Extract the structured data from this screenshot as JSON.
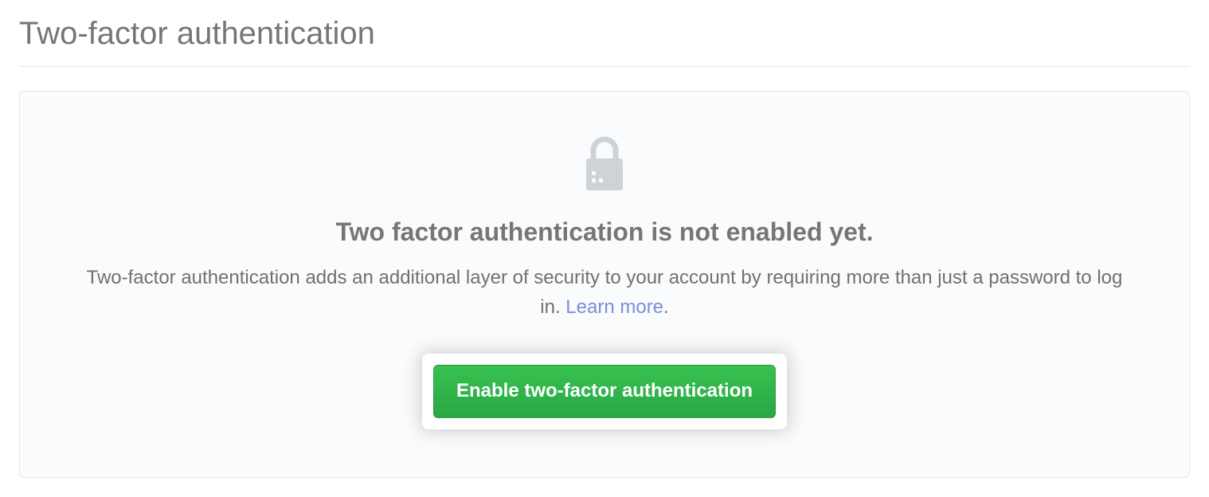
{
  "header": {
    "title": "Two-factor authentication"
  },
  "card": {
    "title": "Two factor authentication is not enabled yet.",
    "desc_part1": "Two-factor authentication adds an additional layer of security to your account by requiring more than just a password to log in. ",
    "learn_more": "Learn more",
    "desc_period": ".",
    "button_label": "Enable two-factor authentication"
  }
}
